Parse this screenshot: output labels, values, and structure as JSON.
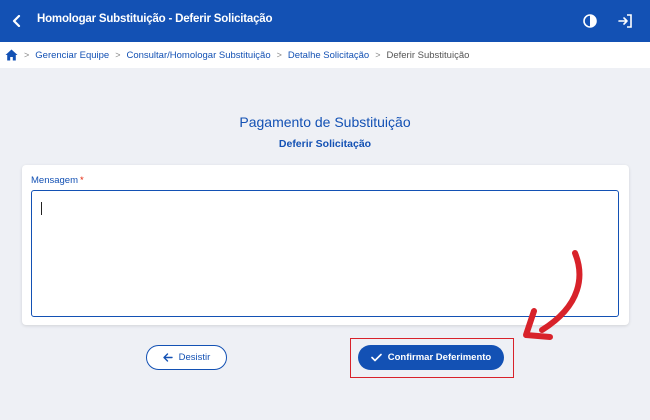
{
  "header": {
    "title": "Homologar Substituição - Deferir Solicitação",
    "back_icon": "chevron-left-icon",
    "contrast_icon": "contrast-icon",
    "logout_icon": "sign-out-icon"
  },
  "breadcrumb": {
    "home_icon": "home-icon",
    "items": [
      "Gerenciar Equipe",
      "Consultar/Homologar Substituição",
      "Detalhe Solicitação",
      "Deferir Substituição"
    ]
  },
  "main": {
    "title": "Pagamento de Substituição",
    "subtitle": "Deferir Solicitação"
  },
  "form": {
    "message_label": "Mensagem",
    "required_mark": "*",
    "message_value": ""
  },
  "actions": {
    "back_label": "Desistir",
    "confirm_label": "Confirmar Deferimento"
  },
  "colors": {
    "primary": "#1351b4",
    "annotation": "#d8222a",
    "background": "#eef0f5"
  }
}
